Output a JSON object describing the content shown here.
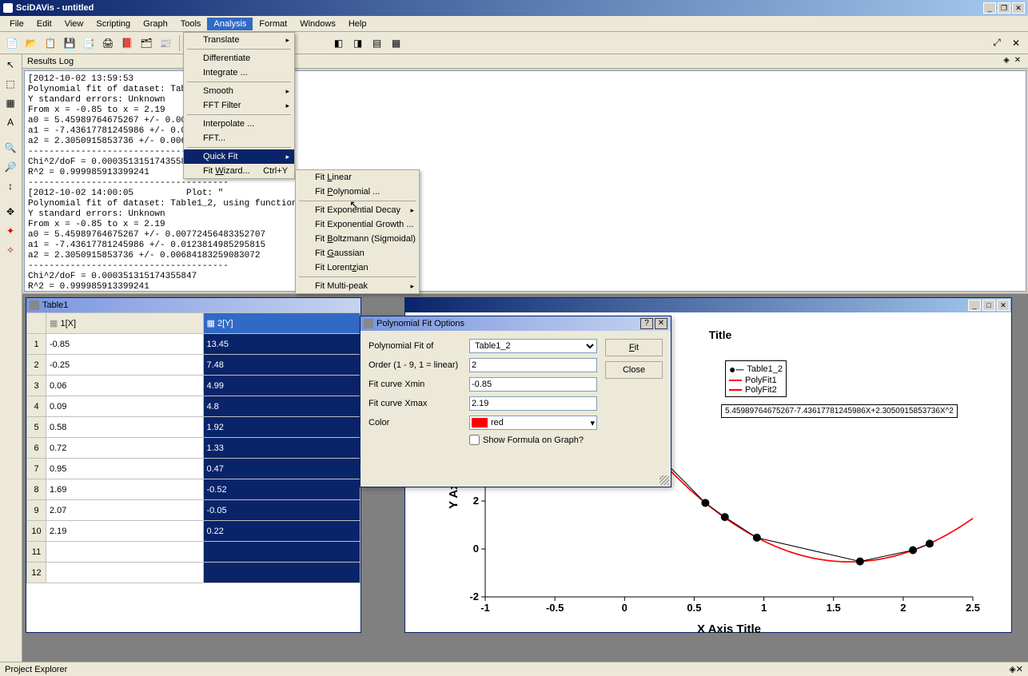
{
  "app": {
    "title": "SciDAVis - untitled"
  },
  "menubar": [
    "File",
    "Edit",
    "View",
    "Scripting",
    "Graph",
    "Tools",
    "Analysis",
    "Format",
    "Windows",
    "Help"
  ],
  "analysis_menu": {
    "translate": "Translate",
    "differentiate": "Differentiate",
    "integrate": "Integrate ...",
    "smooth": "Smooth",
    "fft_filter": "FFT Filter",
    "interpolate": "Interpolate ...",
    "fft": "FFT...",
    "quick_fit": "Quick Fit",
    "fit_wizard": "Fit Wizard...",
    "fit_wizard_shortcut": "Ctrl+Y"
  },
  "quickfit_submenu": {
    "fit_linear": "Fit Linear",
    "fit_polynomial": "Fit Polynomial ...",
    "fit_exp_decay": "Fit Exponential Decay",
    "fit_exp_growth": "Fit Exponential Growth ...",
    "fit_boltzmann": "Fit Boltzmann (Sigmoidal)",
    "fit_gaussian": "Fit Gaussian",
    "fit_lorentzian": "Fit Lorentzian",
    "fit_multipeak": "Fit Multi-peak"
  },
  "results_log": {
    "title": "Results Log",
    "text": "[2012-10-02 13:59:53          Plot: \"\nPolynomial fit of dataset: Table1_2, usi\nY standard errors: Unknown\nFrom x = -0.85 to x = 2.19\na0 = 5.45989764675267 +/- 0.007724\na1 = -7.43617781245986 +/- 0.01238\na2 = 2.3050915853736 +/- 0.0068418\n--------------------------------------\nChi^2/doF = 0.000351315174355847\nR^2 = 0.999985913399241\n--------------------------------------\n[2012-10-02 14:00:05          Plot: \"\nPolynomial fit of dataset: Table1_2, using function: a0+a1*x+a2*x^2\nY standard errors: Unknown\nFrom x = -0.85 to x = 2.19\na0 = 5.45989764675267 +/- 0.00772456483352707\na1 = -7.43617781245986 +/- 0.0123814985295815\na2 = 2.3050915853736 +/- 0.00684183259083072\n--------------------------------------\nChi^2/doF = 0.000351315174355847\nR^2 = 0.999985913399241"
  },
  "table": {
    "name": "Table1",
    "headers": {
      "row": "",
      "col1": "1[X]",
      "col2": "2[Y]"
    },
    "rows": [
      {
        "n": "1",
        "x": "-0.85",
        "y": "13.45"
      },
      {
        "n": "2",
        "x": "-0.25",
        "y": "7.48"
      },
      {
        "n": "3",
        "x": "0.06",
        "y": "4.99"
      },
      {
        "n": "4",
        "x": "0.09",
        "y": "4.8"
      },
      {
        "n": "5",
        "x": "0.58",
        "y": "1.92"
      },
      {
        "n": "6",
        "x": "0.72",
        "y": "1.33"
      },
      {
        "n": "7",
        "x": "0.95",
        "y": "0.47"
      },
      {
        "n": "8",
        "x": "1.69",
        "y": "-0.52"
      },
      {
        "n": "9",
        "x": "2.07",
        "y": "-0.05"
      },
      {
        "n": "10",
        "x": "2.19",
        "y": "0.22"
      },
      {
        "n": "11",
        "x": "",
        "y": ""
      },
      {
        "n": "12",
        "x": "",
        "y": ""
      }
    ]
  },
  "dialog": {
    "title": "Polynomial Fit Options",
    "fit_of_label": "Polynomial Fit of",
    "fit_of_value": "Table1_2",
    "order_label": "Order (1 - 9, 1 = linear)",
    "order_value": "2",
    "xmin_label": "Fit curve Xmin",
    "xmin_value": "-0.85",
    "xmax_label": "Fit curve Xmax",
    "xmax_value": "2.19",
    "color_label": "Color",
    "color_value": "red",
    "show_formula_label": "Show Formula on Graph?",
    "fit_btn": "Fit",
    "close_btn": "Close"
  },
  "graph": {
    "title": "Title",
    "xlabel": "X Axis Title",
    "ylabel": "Y Axis Title",
    "legend": [
      "Table1_2",
      "PolyFit1",
      "PolyFit2"
    ],
    "formula": "5.45989764675267-7.43617781245986X+2.3050915853736X^2"
  },
  "project_explorer": "Project Explorer",
  "chart_data": {
    "type": "scatter",
    "title": "Title",
    "xlabel": "X Axis Title",
    "ylabel": "Y Axis Title",
    "xlim": [
      -1,
      2.5
    ],
    "ylim": [
      -2,
      8
    ],
    "xticks": [
      -1,
      -0.5,
      0,
      0.5,
      1,
      1.5,
      2,
      2.5
    ],
    "yticks": [
      -2,
      0,
      2,
      4,
      6,
      8
    ],
    "series": [
      {
        "name": "Table1_2",
        "type": "scatter",
        "color": "#000000",
        "x": [
          -0.85,
          -0.25,
          0.06,
          0.09,
          0.58,
          0.72,
          0.95,
          1.69,
          2.07,
          2.19
        ],
        "y": [
          13.45,
          7.48,
          4.99,
          4.8,
          1.92,
          1.33,
          0.47,
          -0.52,
          -0.05,
          0.22
        ]
      },
      {
        "name": "PolyFit1",
        "type": "line",
        "color": "#ff0000",
        "coefficients": [
          5.45989764675267,
          -7.43617781245986,
          2.3050915853736
        ]
      },
      {
        "name": "PolyFit2",
        "type": "line",
        "color": "#ff0000",
        "coefficients": [
          5.45989764675267,
          -7.43617781245986,
          2.3050915853736
        ]
      }
    ]
  }
}
